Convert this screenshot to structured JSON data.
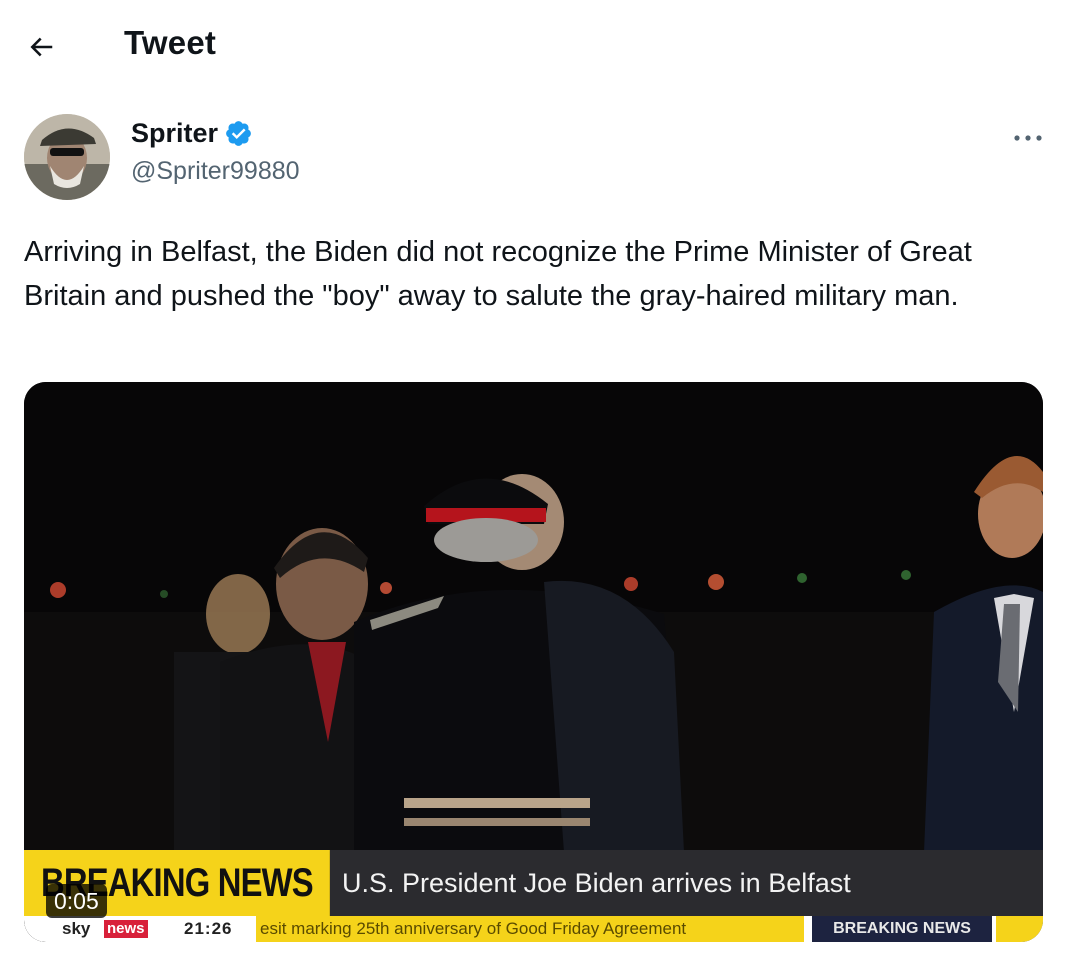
{
  "header": {
    "title": "Tweet",
    "back_icon": "arrow-left-icon"
  },
  "author": {
    "name": "Spriter",
    "handle": "@Spriter99880",
    "verified": true,
    "badge_color": "#1d9bf0"
  },
  "tweet": {
    "text": "Arriving in Belfast, the Biden did not recognize the Prime Minister of Great Britain and pushed the \"boy\" away to salute the gray-haired military man."
  },
  "video": {
    "duration": "0:05",
    "lower_third": {
      "breaking": "BREAKING NEWS",
      "headline": "U.S. President Joe Biden arrives in Belfast"
    },
    "ticker": {
      "brand": "sky",
      "brand_box": "news",
      "time": "21:26",
      "text": "esit marking 25th anniversary of Good Friday Agreement",
      "label": "BREAKING NEWS"
    }
  },
  "colors": {
    "text": "#0f1419",
    "secondary": "#536471",
    "accent": "#1d9bf0",
    "breaking_yellow": "#f5d31a"
  }
}
